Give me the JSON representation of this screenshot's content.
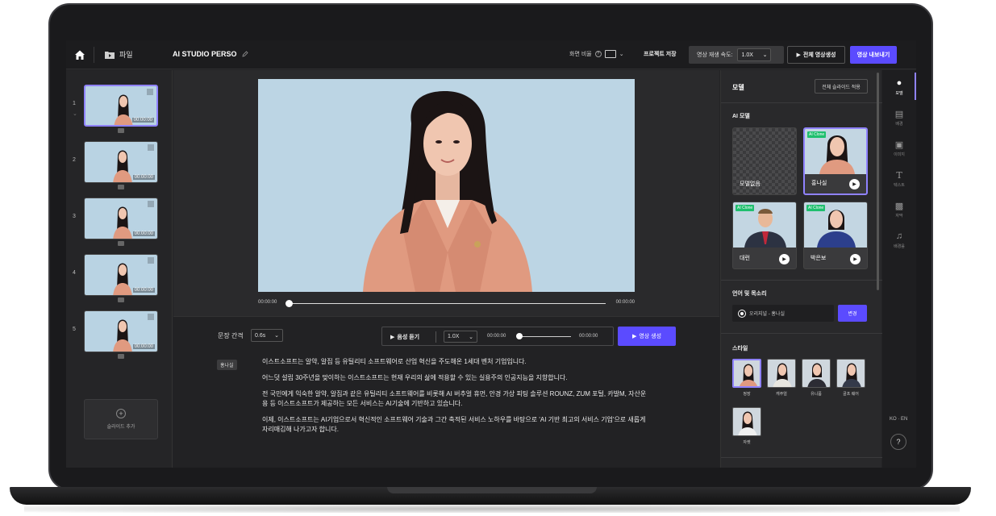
{
  "topbar": {
    "file_label": "파일",
    "project_title": "AI STUDIO PERSO",
    "ratio_label": "화면 비율",
    "save_label": "프로젝트 저장",
    "speed_label": "영상 재생 속도:",
    "speed_value": "1.0X",
    "full_generate_label": "전체 영상생성",
    "export_label": "영상 내보내기"
  },
  "slides": {
    "items": [
      {
        "num": "1",
        "time": "00:00:00",
        "active": true
      },
      {
        "num": "2",
        "time": "00:00:00",
        "active": false
      },
      {
        "num": "3",
        "time": "00:00:00",
        "active": false
      },
      {
        "num": "4",
        "time": "00:00:00",
        "active": false
      },
      {
        "num": "5",
        "time": "00:00:00",
        "active": false
      }
    ],
    "add_label": "슬라이드 추가"
  },
  "player": {
    "time_start": "00:00:00",
    "time_end": "00:00:00"
  },
  "editor": {
    "gap_label": "문장 간격",
    "gap_value": "0.6s",
    "listen_label": "음성 듣기",
    "speed_value": "1.0X",
    "audio_time_start": "00:00:00",
    "audio_time_end": "00:00:00",
    "generate_label": "영상 생성",
    "speaker": "홍나실",
    "paragraphs": [
      "이스트소프트는 알약, 알집 등 유틸리티 소프트웨어로 산업 혁신을 주도해온 1세대 벤처 기업입니다.",
      "어느덧 설립 30주년을 맞이하는 이스트소프트는 현재 우리의 삶에 적용할 수 있는 실용주의 인공지능을 지향합니다.",
      "전 국민에게 익숙한 알약, 알집과 같은 유틸리티 소프트웨어를 비롯해 AI 버추얼 휴먼, 안경 가상 피팅 솔루션 ROUNZ, ZUM 포털, 카발M, 자산운용 등 이스트소프트가 제공하는 모든 서비스는 AI기술에 기반하고 있습니다.",
      "이제, 이스트소프트는 AI기업으로서 혁신적인 소프트웨어 기술과 그간 축적된 서비스 노하우를 바탕으로 'AI 기반 최고의 서비스 기업'으로 새롭게 자리매김해 나가고자 합니다."
    ]
  },
  "right_panel": {
    "title": "모델",
    "apply_all_label": "전체 슬라이드 적용",
    "ai_model_label": "AI 모델",
    "models": [
      {
        "name": "모델없음",
        "badge": "",
        "selected": false
      },
      {
        "name": "홍나실",
        "badge": "AI Clone",
        "selected": true
      },
      {
        "name": "대런",
        "badge": "AI Clone",
        "selected": false
      },
      {
        "name": "박은보",
        "badge": "AI Clone",
        "selected": false
      }
    ],
    "voice_label": "언어 및 목소리",
    "voice_value": "오리지널 - 홍나실",
    "change_label": "변경",
    "style_label": "스타일",
    "styles": [
      {
        "name": "정장",
        "selected": true
      },
      {
        "name": "캐주얼",
        "selected": false
      },
      {
        "name": "유니폼",
        "selected": false
      },
      {
        "name": "골프 웨어",
        "selected": false
      },
      {
        "name": "자켓",
        "selected": false
      }
    ]
  },
  "rail": {
    "items": [
      {
        "label": "모델",
        "icon": "person-icon"
      },
      {
        "label": "배경",
        "icon": "background-icon"
      },
      {
        "label": "이미지",
        "icon": "image-icon"
      },
      {
        "label": "텍스트",
        "icon": "text-icon"
      },
      {
        "label": "자막",
        "icon": "subtitle-icon"
      },
      {
        "label": "배경음",
        "icon": "music-icon"
      }
    ],
    "language_switch": "KO · EN",
    "help": "?"
  }
}
